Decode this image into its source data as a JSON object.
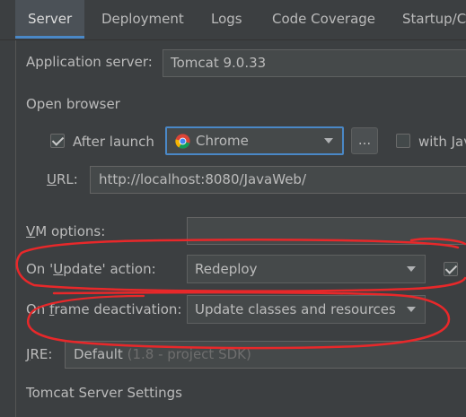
{
  "tabs": [
    "Server",
    "Deployment",
    "Logs",
    "Code Coverage",
    "Startup/C"
  ],
  "server": {
    "app_server_label": "Application server:",
    "app_server_value": "Tomcat 9.0.33",
    "open_browser_label": "Open browser",
    "after_launch_label": "After launch",
    "after_launch_checked": true,
    "browser_value": "Chrome",
    "browse_button_label": "...",
    "with_js_label": "with Jav",
    "with_js_checked": false,
    "url_label": "URL:",
    "url_value": "http://localhost:8080/JavaWeb/",
    "vm_options_label": "VM options:",
    "vm_options_value": "",
    "on_update_label": "On 'Update' action:",
    "on_update_value": "Redeploy",
    "on_update_checked": true,
    "on_frame_label": "On frame deactivation:",
    "on_frame_value": "Update classes and resources",
    "jre_label": "JRE:",
    "jre_value": "Default",
    "jre_hint": "(1.8 - project SDK)",
    "tomcat_settings_label": "Tomcat Server Settings"
  },
  "colors": {
    "background": "#3c3f41",
    "accent": "#4a88c7",
    "annotation_red": "#e8282a"
  }
}
